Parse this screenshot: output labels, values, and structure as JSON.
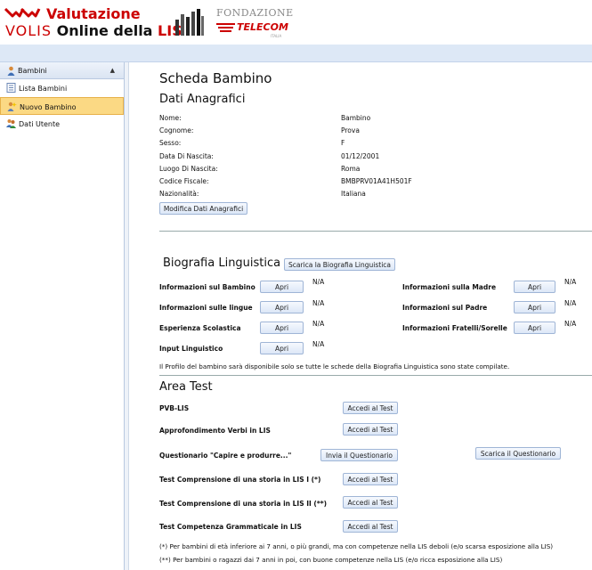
{
  "header": {
    "logo_line1_red": "Valutazione",
    "logo_line2_volis": "VOLIS",
    "logo_line2_online": "Online della ",
    "logo_line2_lis": "LIS",
    "sponsor_top": "FONDAZIONE",
    "sponsor_name": "TELECOM",
    "sponsor_sub": "ITALIA"
  },
  "sidebar": {
    "section_label": "Bambini",
    "items": [
      {
        "label": "Lista Bambini",
        "icon": "list-icon"
      },
      {
        "label": "Nuovo Bambino",
        "icon": "new-child-icon"
      },
      {
        "label": "Dati Utente",
        "icon": "users-icon"
      }
    ]
  },
  "page": {
    "title": "Scheda Bambino",
    "section_anagrafici": "Dati Anagrafici",
    "anagrafici": [
      {
        "label": "Nome:",
        "value": "Bambino"
      },
      {
        "label": "Cognome:",
        "value": "Prova"
      },
      {
        "label": "Sesso:",
        "value": "F"
      },
      {
        "label": "Data Di Nascita:",
        "value": "01/12/2001"
      },
      {
        "label": "Luogo Di Nascita:",
        "value": "Roma"
      },
      {
        "label": "Codice Fiscale:",
        "value": "BMBPRV01A41H501F"
      },
      {
        "label": "Nazionalità:",
        "value": "Italiana"
      }
    ],
    "edit_button": "Modifica Dati Anagrafici"
  },
  "biografia": {
    "title": "Biografia Linguistica",
    "download_button": "Scarica la Biografia Linguistica",
    "open_label": "Apri",
    "na": "N/A",
    "left": [
      "Informazioni sul Bambino",
      "Informazioni sulle lingue",
      "Esperienza Scolastica",
      "Input Linguistico"
    ],
    "right": [
      "Informazioni sulla Madre",
      "Informazioni sul Padre",
      "Informazioni Fratelli/Sorelle"
    ],
    "note": "Il Profilo del bambino sarà disponibile solo se tutte le schede della Biografia Linguistica sono state compilate."
  },
  "tests": {
    "title": "Area Test",
    "access_label": "Accedi al Test",
    "items": [
      {
        "label": "PVB-LIS"
      },
      {
        "label": "Approfondimento Verbi in LIS"
      },
      {
        "label": "Questionario \"Capire e produrre...\""
      },
      {
        "label": "Test Comprensione di una storia in LIS I (*)"
      },
      {
        "label": "Test Comprensione di una storia in LIS II (**)"
      },
      {
        "label": "Test Competenza Grammaticale in LIS"
      }
    ],
    "send_questionnaire": "Invia il Questionario",
    "download_questionnaire": "Scarica il Questionario",
    "footnote1": "(*) Per bambini di età inferiore ai 7 anni, o più grandi, ma con competenze nella LIS deboli (e/o scarsa esposizione alla LIS)",
    "footnote2": "(**) Per bambini o ragazzi dai 7 anni in poi, con buone competenze nella LIS (e/o ricca esposizione alla LIS)"
  },
  "colors": {
    "brand_red": "#cc0000",
    "header_blue": "#dde8f6",
    "active_item": "#fbd984"
  }
}
